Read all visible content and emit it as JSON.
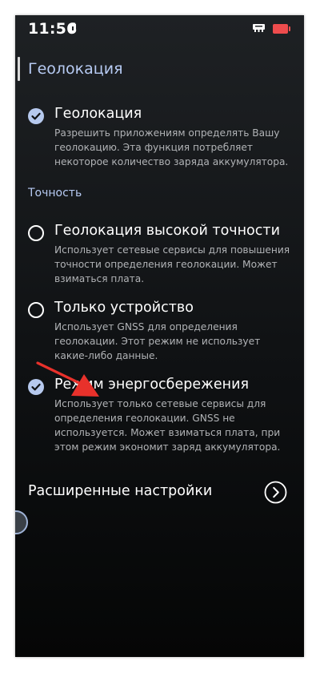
{
  "status_bar": {
    "time": "11:56",
    "battery_color": "#ee4c4d"
  },
  "page": {
    "title": "Геолокация"
  },
  "location_toggle": {
    "title": "Геолокация",
    "description": "Разрешить приложениям определять Вашу геолокацию. Эта функция потребляет некоторое количество заряда аккумулятора.",
    "checked": true
  },
  "accuracy": {
    "section_label": "Точность",
    "options": [
      {
        "title": "Геолокация высокой точности",
        "description": "Использует сетевые сервисы для повышения точности определения геолокации. Может взиматься плата.",
        "selected": false
      },
      {
        "title": "Только устройство",
        "description": "Использует GNSS для определения геолокации. Этот режим не использует какие-либо данные.",
        "selected": false
      },
      {
        "title": "Режим энергосбережения",
        "description": "Использует только сетевые сервисы для определения геолокации. GNSS не используется. Может взиматься плата, при этом режим экономит заряд аккумулятора.",
        "selected": true
      }
    ]
  },
  "advanced": {
    "label": "Расширенные настройки"
  },
  "colors": {
    "accent": "#b7cbf3",
    "check_fill": "#b6c9ee",
    "annotation_arrow": "#e8312b"
  },
  "icons": {
    "status_shield": "shield-icon",
    "status_network": "network-icon",
    "checkbox": "check-icon",
    "advanced": "chevron-right-circle-icon",
    "annotation": "red-arrow-icon"
  }
}
